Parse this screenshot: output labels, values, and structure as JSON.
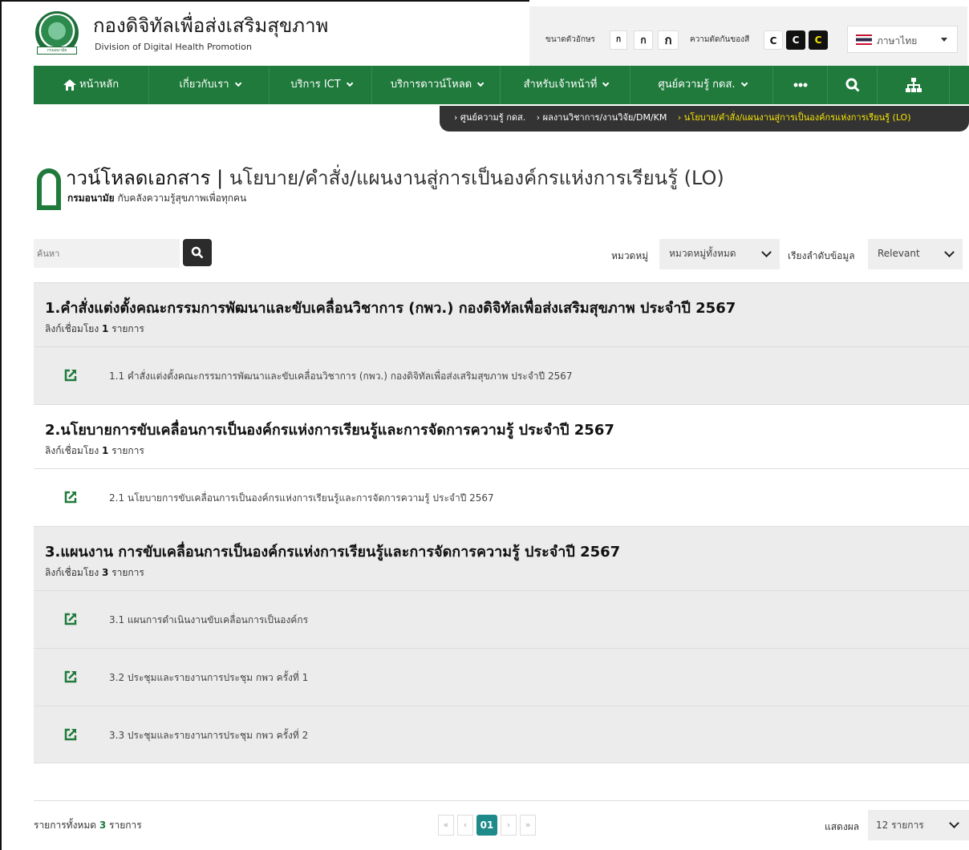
{
  "header": {
    "site_title": "กองดิจิทัลเพื่อส่งเสริมสุขภาพ",
    "site_subtitle": "Division of Digital Health Promotion",
    "logo_ribbon": "กรมอนามัย",
    "font_size_label": "ขนาดตัวอักษร",
    "font_size_buttons": [
      "ก",
      "ก",
      "ก"
    ],
    "contrast_label": "ความตัดกันของสี",
    "contrast_buttons": [
      "C",
      "C",
      "C"
    ],
    "language": "ภาษาไทย"
  },
  "nav": {
    "items": [
      {
        "label": "หน้าหลัก",
        "icon": "home-icon"
      },
      {
        "label": "เกี่ยวกับเรา"
      },
      {
        "label": "บริการ ICT"
      },
      {
        "label": "บริการดาวน์โหลด"
      },
      {
        "label": "สำหรับเจ้าหน้าที่"
      },
      {
        "label": "ศูนย์ความรู้ กดส."
      }
    ],
    "more_icon": "more-icon",
    "search_icon": "search-icon",
    "sitemap_icon": "sitemap-icon"
  },
  "breadcrumb": [
    "› ศูนย์ความรู้ กดส.",
    "› ผลงานวิชาการ/งานวิจัย/DM/KM",
    "› นโยบาย/คำสั่ง/แผนงานสู่การเป็นองค์กรแห่งการเรียนรู้ (LO)"
  ],
  "page": {
    "title_main": "าวน์โหลดเอกสาร",
    "title_sep": " | ",
    "title_section": "นโยบาย/คำสั่ง/แผนงานสู่การเป็นองค์กรแห่งการเรียนรู้ (LO)",
    "tagline_bold": "กรมอนามัย",
    "tagline_rest": " กับคลังความรู้สุขภาพเพื่อทุกคน"
  },
  "toolbar": {
    "search_placeholder": "ค้นหา",
    "category_label": "หมวดหมู่",
    "category_value": "หมวดหมู่ทั้งหมด",
    "sort_label": "เรียงลำดับข้อมูล",
    "sort_value": "Relevant"
  },
  "sections": [
    {
      "title": "1.คำสั่งแต่งตั้งคณะกรรมการพัฒนาและขับเคลื่อนวิชาการ (กพว.) กองดิจิทัลเพื่อส่งเสริมสุขภาพ ประจำปี 2567",
      "count_prefix": "ลิงก์เชื่อมโยง ",
      "count": "1",
      "count_suffix": " รายการ",
      "links": [
        "1.1 คำสั่งแต่งตั้งคณะกรรมการพัฒนาและขับเคลื่อนวิชาการ (กพว.) กองดิจิทัลเพื่อส่งเสริมสุขภาพ ประจำปี 2567"
      ]
    },
    {
      "title": "2.นโยบายการขับเคลื่อนการเป็นองค์กรแห่งการเรียนรู้และการจัดการความรู้ ประจำปี 2567",
      "count_prefix": "ลิงก์เชื่อมโยง ",
      "count": "1",
      "count_suffix": " รายการ",
      "links": [
        "2.1 นโยบายการขับเคลื่อนการเป็นองค์กรแห่งการเรียนรู้และการจัดการความรู้ ประจำปี 2567"
      ]
    },
    {
      "title": "3.แผนงาน การขับเคลื่อนการเป็นองค์กรแห่งการเรียนรู้และการจัดการความรู้ ประจำปี 2567",
      "count_prefix": "ลิงก์เชื่อมโยง ",
      "count": "3",
      "count_suffix": " รายการ",
      "links": [
        "3.1 แผนการดำเนินงานขับเคลื่อนการเป็นองค์กร",
        "3.2 ประชุมและรายงานการประชุม กพว ครั้งที่ 1",
        "3.3 ประชุมและรายงานการประชุม กพว ครั้งที่ 2"
      ]
    }
  ],
  "footer": {
    "total_prefix": "รายการทั้งหมด ",
    "total_count": "3",
    "total_suffix": " รายการ",
    "pager_first": "«",
    "pager_prev": "‹",
    "pager_current": "01",
    "pager_next": "›",
    "pager_last": "»",
    "show_label": "แสดงผล",
    "per_page_value": "12 รายการ"
  },
  "colors": {
    "nav_green": "#1f7a3c",
    "breadcrumb_bg": "#333333",
    "breadcrumb_current": "#f4e400",
    "pager_active": "#1f8a8a",
    "contrast_yellow": "#f4e400"
  }
}
